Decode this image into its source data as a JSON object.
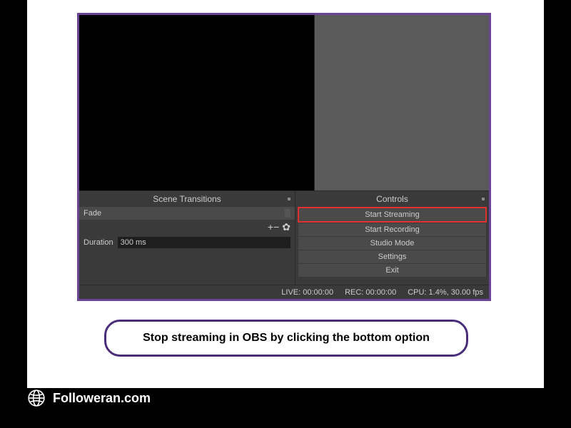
{
  "panels": {
    "scene_transitions": {
      "header": "Scene Transitions",
      "transition_name": "Fade",
      "duration_label": "Duration",
      "duration_value": "300 ms"
    },
    "controls": {
      "header": "Controls",
      "buttons": {
        "start_streaming": "Start Streaming",
        "start_recording": "Start Recording",
        "studio_mode": "Studio Mode",
        "settings": "Settings",
        "exit": "Exit"
      }
    }
  },
  "status": {
    "live": "LIVE: 00:00:00",
    "rec": "REC: 00:00:00",
    "cpu": "CPU: 1.4%, 30.00 fps"
  },
  "caption": "Stop streaming in OBS by clicking the bottom option",
  "footer": "Followeran.com",
  "icons": {
    "plus": "+",
    "minus": "−",
    "gear": "✿"
  }
}
